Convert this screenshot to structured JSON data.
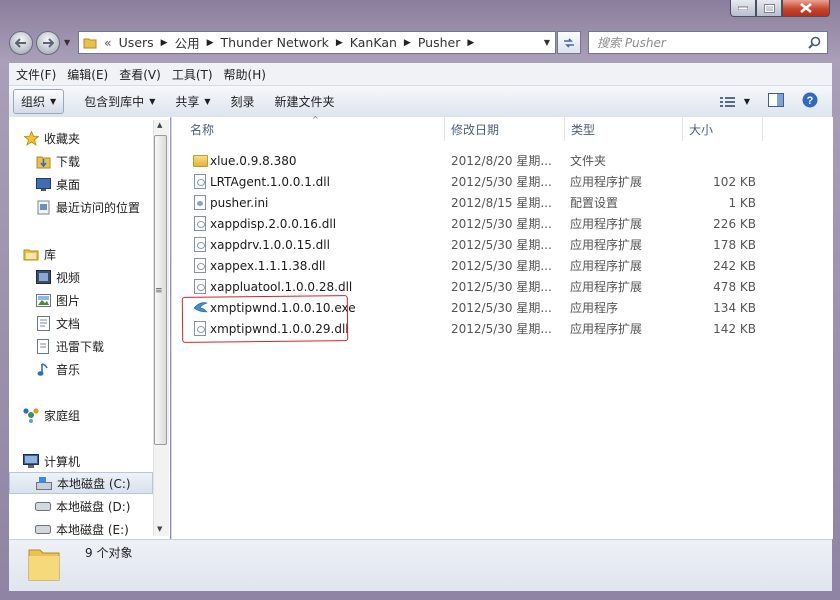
{
  "window": {
    "caption": {
      "minimize": "—",
      "maximize": "□",
      "close": "✕"
    }
  },
  "nav": {
    "back_icon": "arrow-left-icon",
    "forward_icon": "arrow-right-icon",
    "breadcrumb": [
      "«",
      "Users",
      "公用",
      "Thunder Network",
      "KanKan",
      "Pusher"
    ],
    "search_placeholder": "搜索 Pusher"
  },
  "menubar": {
    "items": [
      "文件(F)",
      "编辑(E)",
      "查看(V)",
      "工具(T)",
      "帮助(H)"
    ]
  },
  "toolbar": {
    "organize": "组织",
    "include_library": "包含到库中",
    "share": "共享",
    "burn": "刻录",
    "new_folder": "新建文件夹"
  },
  "sidebar": {
    "favorites": {
      "label": "收藏夹",
      "items": [
        "下载",
        "桌面",
        "最近访问的位置"
      ]
    },
    "libraries": {
      "label": "库",
      "items": [
        "视频",
        "图片",
        "文档",
        "迅雷下载",
        "音乐"
      ]
    },
    "homegroup": {
      "label": "家庭组"
    },
    "computer": {
      "label": "计算机",
      "items": [
        "本地磁盘 (C:)",
        "本地磁盘 (D:)",
        "本地磁盘 (E:)"
      ]
    }
  },
  "columns": {
    "name": "名称",
    "date": "修改日期",
    "type": "类型",
    "size": "大小"
  },
  "files": [
    {
      "name": "xlue.0.9.8.380",
      "date": "2012/8/20 星期...",
      "type": "文件夹",
      "size": "",
      "icon": "folder"
    },
    {
      "name": "LRTAgent.1.0.0.1.dll",
      "date": "2012/5/30 星期...",
      "type": "应用程序扩展",
      "size": "102 KB",
      "icon": "dll"
    },
    {
      "name": "pusher.ini",
      "date": "2012/8/15 星期...",
      "type": "配置设置",
      "size": "1 KB",
      "icon": "ini"
    },
    {
      "name": "xappdisp.2.0.0.16.dll",
      "date": "2012/5/30 星期...",
      "type": "应用程序扩展",
      "size": "226 KB",
      "icon": "dll"
    },
    {
      "name": "xappdrv.1.0.0.15.dll",
      "date": "2012/5/30 星期...",
      "type": "应用程序扩展",
      "size": "178 KB",
      "icon": "dll"
    },
    {
      "name": "xappex.1.1.1.38.dll",
      "date": "2012/5/30 星期...",
      "type": "应用程序扩展",
      "size": "242 KB",
      "icon": "dll"
    },
    {
      "name": "xappluatool.1.0.0.28.dll",
      "date": "2012/5/30 星期...",
      "type": "应用程序扩展",
      "size": "478 KB",
      "icon": "dll"
    },
    {
      "name": "xmptipwnd.1.0.0.10.exe",
      "date": "2012/5/30 星期...",
      "type": "应用程序",
      "size": "134 KB",
      "icon": "exe"
    },
    {
      "name": "xmptipwnd.1.0.0.29.dll",
      "date": "2012/5/30 星期...",
      "type": "应用程序扩展",
      "size": "142 KB",
      "icon": "dll"
    }
  ],
  "status": {
    "count": "9 个对象"
  },
  "colors": {
    "accent": "#3c6bb0",
    "highlight": "#d2242a"
  }
}
